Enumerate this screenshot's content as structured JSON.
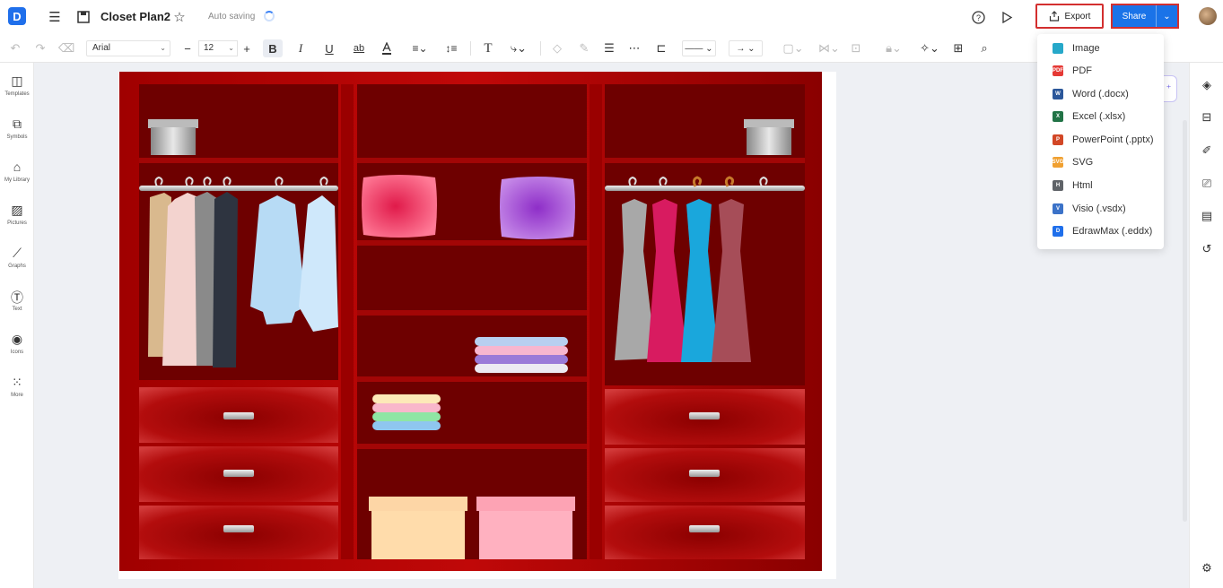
{
  "header": {
    "logo_glyph": "D",
    "title": "Closet Plan2",
    "autosave": "Auto saving",
    "export_label": "Export",
    "share_label": "Share"
  },
  "toolbar": {
    "font_family": "Arial",
    "font_size": "12",
    "bold": "B",
    "italic": "I",
    "underline": "U",
    "strike": "ab",
    "text_tool": "T"
  },
  "sidebar": {
    "items": [
      {
        "label": "Templates",
        "icon": "templates-icon"
      },
      {
        "label": "Symbols",
        "icon": "symbols-icon"
      },
      {
        "label": "My Library",
        "icon": "library-icon"
      },
      {
        "label": "Pictures",
        "icon": "pictures-icon"
      },
      {
        "label": "Graphs",
        "icon": "graphs-icon"
      },
      {
        "label": "Text",
        "icon": "text-icon"
      },
      {
        "label": "Icons",
        "icon": "icons-icon"
      },
      {
        "label": "More",
        "icon": "more-icon"
      }
    ]
  },
  "export_menu": {
    "items": [
      {
        "label": "Image",
        "badge": "",
        "color": "#26a8c9"
      },
      {
        "label": "PDF",
        "badge": "PDF",
        "color": "#e53935"
      },
      {
        "label": "Word (.docx)",
        "badge": "W",
        "color": "#2b579a"
      },
      {
        "label": "Excel (.xlsx)",
        "badge": "X",
        "color": "#217346"
      },
      {
        "label": "PowerPoint (.pptx)",
        "badge": "P",
        "color": "#d24726"
      },
      {
        "label": "SVG",
        "badge": "SVG",
        "color": "#f0a030"
      },
      {
        "label": "Html",
        "badge": "H",
        "color": "#5f6368"
      },
      {
        "label": "Visio (.vsdx)",
        "badge": "V",
        "color": "#3b72c8"
      },
      {
        "label": "EdrawMax (.eddx)",
        "badge": "D",
        "color": "#1f6feb"
      }
    ]
  },
  "colors": {
    "accent": "#1a73e8",
    "highlight": "#d32f2f",
    "closet": "#8b0000"
  }
}
